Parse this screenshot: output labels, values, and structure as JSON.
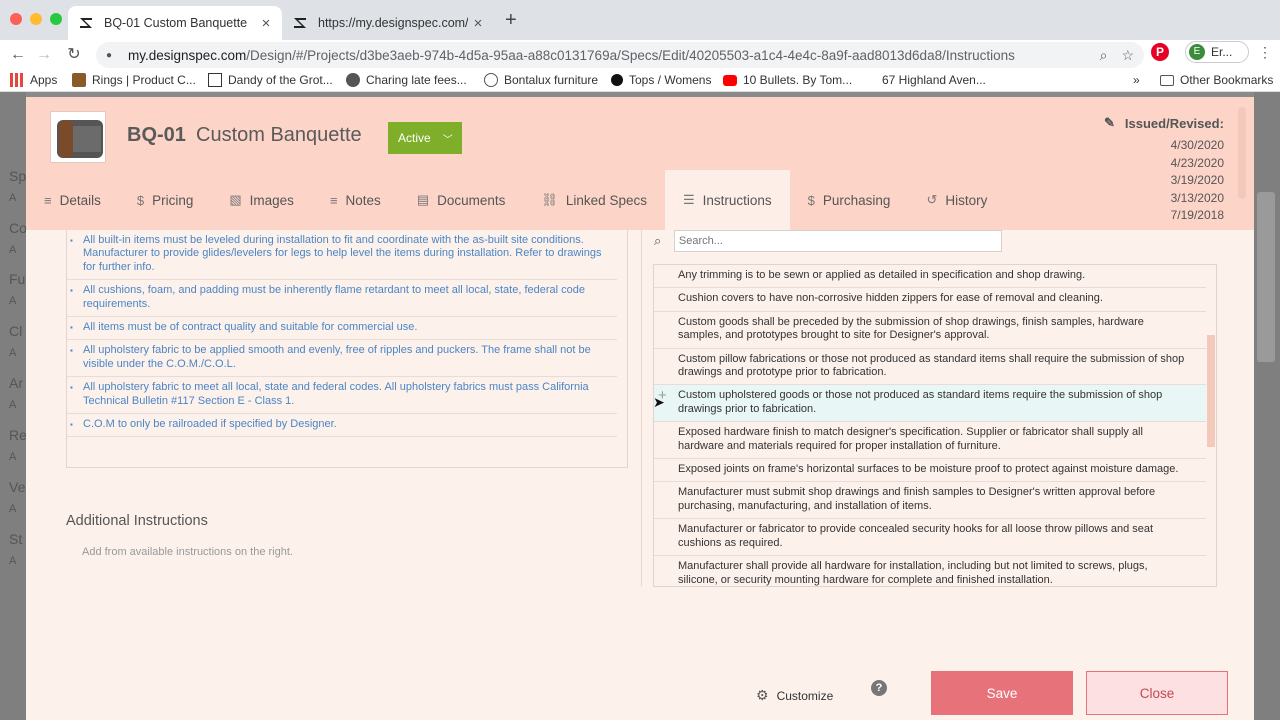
{
  "browser": {
    "tabs": [
      {
        "title": "BQ-01 Custom Banquette",
        "active": true
      },
      {
        "title": "https://my.designspec.com/#/S",
        "active": false
      }
    ],
    "url_host": "my.designspec.com",
    "url_path": "/Design/#/Projects/d3be3aeb-974b-4d5a-95aa-a88c0131769a/Specs/Edit/40205503-a1c4-4e4c-8a9f-aad8013d6da8/Instructions",
    "profile_label": "Er...",
    "profile_initial": "E",
    "bookmarks": [
      "Apps",
      "Rings | Product C...",
      "Dandy of the Grot...",
      "Charing late fees...",
      "Bontalux furniture",
      "Tops / Womens",
      "10 Bullets. By Tom...",
      "67 Highland Aven..."
    ],
    "more_bookmarks": "»",
    "other_bookmarks": "Other Bookmarks"
  },
  "left_strip_letters": [
    "Sp",
    "A",
    "Co",
    "A",
    "Fu",
    "A",
    "Cl",
    "A",
    "Ar",
    "A",
    "Re",
    "A",
    "Ve",
    "A",
    "St",
    "A"
  ],
  "header": {
    "code": "BQ-01",
    "name": "Custom Banquette",
    "status": "Active",
    "issued_label": "Issued/Revised:",
    "dates": [
      "4/30/2020",
      "4/23/2020",
      "3/19/2020",
      "3/13/2020",
      "7/19/2018"
    ]
  },
  "tabs": [
    {
      "label": "Details",
      "icon": "≡"
    },
    {
      "label": "Pricing",
      "icon": "$"
    },
    {
      "label": "Images",
      "icon": "▧"
    },
    {
      "label": "Notes",
      "icon": "≡"
    },
    {
      "label": "Documents",
      "icon": "▤"
    },
    {
      "label": "Linked Specs",
      "icon": "⛓"
    },
    {
      "label": "Instructions",
      "icon": "☰"
    },
    {
      "label": "Purchasing",
      "icon": "$"
    },
    {
      "label": "History",
      "icon": "↺"
    }
  ],
  "selected_instructions": [
    "All built-in items must be leveled during installation to fit and coordinate with the as-built site conditions. Manufacturer to provide glides/levelers for legs to help level the items during installation. Refer to drawings for further info.",
    "All cushions, foam, and padding must be inherently flame retardant to meet all local, state, federal code requirements.",
    "All items must be of contract quality and suitable for commercial use.",
    "All upholstery fabric to be applied smooth and evenly, free of ripples and puckers. The frame shall not be visible under the C.O.M./C.O.L.",
    "All upholstery fabric to meet all local, state and federal codes. All upholstery fabrics must pass California Technical Bulletin #117 Section E - Class 1.",
    "C.O.M to only be railroaded if specified by Designer."
  ],
  "additional": {
    "title": "Additional Instructions",
    "hint": "Add from available instructions on the right."
  },
  "search": {
    "placeholder": "Search..."
  },
  "available_instructions": [
    "Any trimming is to be sewn or applied as detailed in specification and shop drawing.",
    "Cushion covers to have non-corrosive hidden zippers for ease of removal and cleaning.",
    "Custom goods shall be preceded by the submission of shop drawings, finish samples, hardware samples, and prototypes brought to site for Designer's approval.",
    "Custom pillow fabrications or those not produced as standard items shall require the submission of shop drawings and prototype prior to fabrication.",
    "Custom upholstered goods or those not produced as standard items require the submission of shop drawings prior to fabrication.",
    "Exposed hardware finish to match designer's specification. Supplier or fabricator shall supply all hardware and materials required for proper installation of furniture.",
    "Exposed joints on frame's horizontal surfaces to be moisture proof to protect against moisture damage.",
    "Manufacturer must submit shop drawings and finish samples to Designer's written approval before purchasing, manufacturing, and installation of items.",
    "Manufacturer or fabricator to provide concealed security hooks for all loose throw pillows and seat cushions as required.",
    "Manufacturer shall provide all hardware for installation, including but not limited to screws, plugs, silicone, or security mounting hardware for complete and finished installation."
  ],
  "footer": {
    "customize": "Customize",
    "help": "?",
    "save": "Save",
    "close": "Close"
  },
  "colors": {
    "accent": "#e8727a",
    "status": "#7fae2b",
    "header_bg": "#fdd5c8",
    "link": "#4a86c5"
  }
}
